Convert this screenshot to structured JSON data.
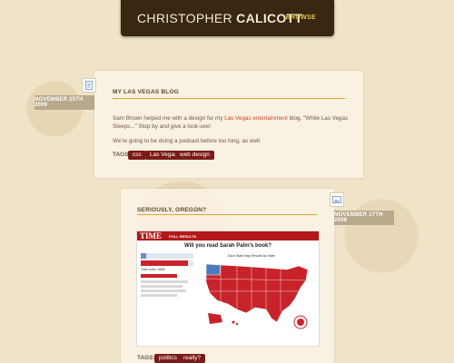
{
  "header": {
    "title_first": "CHRISTOPHER",
    "title_last": "CALICOTT",
    "browse_label": "BROWSE"
  },
  "posts": [
    {
      "date": "NOVEMBER 25TH 2009",
      "title": "MY LAS VEGAS BLOG",
      "body_before_link": "Sam Brown helped me with a design for my ",
      "body_link": "Las Vegas entertainment",
      "body_after_link": " blog, \"While Las Vegas Sleeps...\" Stop by and give a look-see!",
      "body_2": "We're going to be doing a podcast before too long, as well.",
      "tags_label": "TAGS:",
      "tags": [
        "css",
        "Las Vegas",
        "web design"
      ],
      "icon": "document-icon"
    },
    {
      "date": "NOVEMBER 17TH 2009",
      "title": "SERIOUSLY, OREGON?",
      "tags_label": "TAGS:",
      "tags": [
        "politics",
        "really?"
      ],
      "icon": "image-icon",
      "poll": {
        "logo": "TIME",
        "results_label": "POLL RESULTS",
        "question": "Will you read Sarah Palin's book?",
        "map_title": "Each State Map Results By State",
        "yes_percent": 11,
        "no_percent": 89,
        "total_votes": "Total votes: 9848"
      }
    }
  ],
  "colors": {
    "header_bg": "#3a2712",
    "accent": "#e7c34a",
    "tag_bg": "#7b1a17",
    "rule": "#e9a531"
  }
}
